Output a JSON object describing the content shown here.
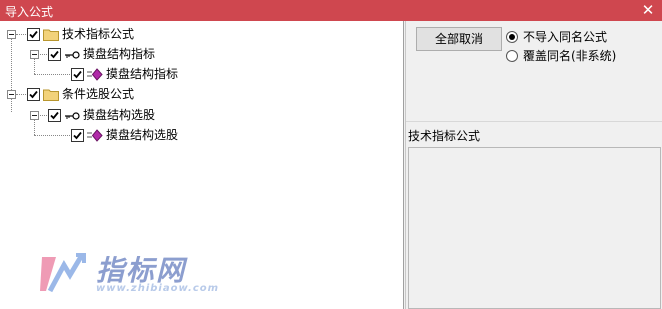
{
  "window": {
    "title": "导入公式",
    "close_glyph": "✕"
  },
  "tree": {
    "groups": [
      {
        "label": "技术指标公式",
        "icon": "folder-icon",
        "checked": true,
        "children": [
          {
            "label": "摸盘结构指标",
            "icon": "key-icon",
            "checked": true,
            "children": [
              {
                "label": "摸盘结构指标",
                "icon": "formula-icon",
                "checked": true
              }
            ]
          }
        ]
      },
      {
        "label": "条件选股公式",
        "icon": "folder-icon",
        "checked": true,
        "children": [
          {
            "label": "摸盘结构选股",
            "icon": "key-icon",
            "checked": true,
            "children": [
              {
                "label": "摸盘结构选股",
                "icon": "formula-icon",
                "checked": true
              }
            ]
          }
        ]
      }
    ]
  },
  "options": {
    "cancel_all_label": "全部取消",
    "radio_no_import": "不导入同名公式",
    "radio_overwrite": "覆盖同名(非系统)",
    "selected": "no_import"
  },
  "info": {
    "section_label": "技术指标公式"
  },
  "watermark": {
    "brand": "指标网",
    "url": "www.zhibiaow.com"
  },
  "colors": {
    "titlebar": "#cf474f",
    "folder": "#f2d27a",
    "formula": "#b02aa8",
    "watermark": "#2f4fa8"
  }
}
